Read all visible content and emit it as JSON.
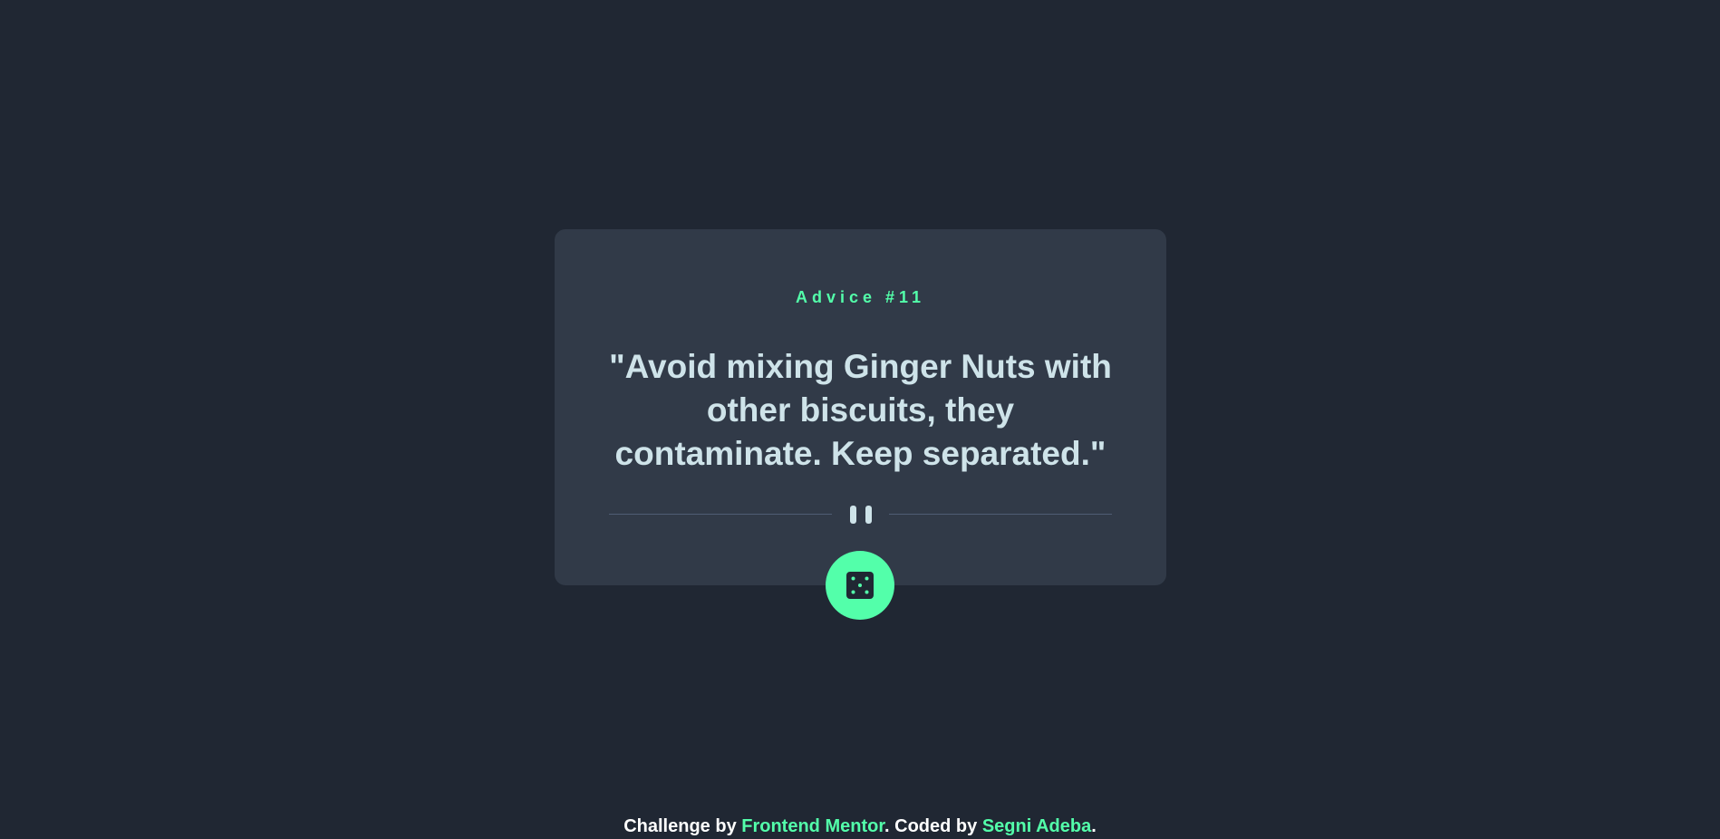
{
  "card": {
    "advice_label": "Advice #11",
    "quote": "\"Avoid mixing Ginger Nuts with other biscuits, they contaminate. Keep separated.\""
  },
  "dice_button": {
    "icon": "dice-icon",
    "aria_label": "Get new advice"
  },
  "footer": {
    "prefix": "Challenge by ",
    "challenge_link": "Frontend Mentor",
    "middle": ". Coded by ",
    "author_link": "Segni Adeba",
    "suffix": "."
  },
  "colors": {
    "background": "#202733",
    "card": "#313a48",
    "accent": "#53ffaa",
    "text": "#cee3e9",
    "divider": "#4f5d74"
  }
}
